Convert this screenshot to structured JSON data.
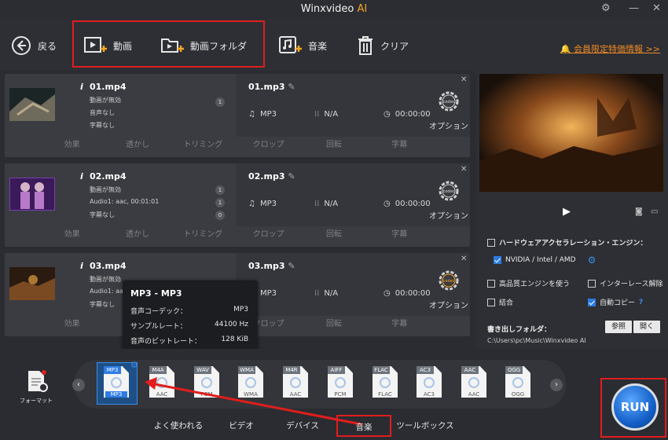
{
  "app": {
    "title_main": "Winxvideo ",
    "title_ai": "AI"
  },
  "toolbar": {
    "back": "戻る",
    "video": "動画",
    "video_folder": "動画フォルダ",
    "music": "音楽",
    "clear": "クリア",
    "member": "会員限定特価情報 >>"
  },
  "rows": [
    {
      "name": "01.mp4",
      "meta1": "動画が無効",
      "meta2": "音声なし",
      "meta3": "字幕なし",
      "badge": "1",
      "out_name": "01.mp3",
      "format": "MP3",
      "res": "N/A",
      "time": "00:00:00",
      "option": "オプション",
      "codec": "codec"
    },
    {
      "name": "02.mp4",
      "meta1": "動画が無効",
      "meta2": "Audio1: aac, 00:01:01",
      "meta3": "字幕なし",
      "badge": "1",
      "badge2": "0",
      "out_name": "02.mp3",
      "format": "MP3",
      "res": "N/A",
      "time": "00:00:00",
      "option": "オプション",
      "codec": "codec"
    },
    {
      "name": "03.mp4",
      "meta1": "動画が無効",
      "meta2": "Audio1: aac, 00:01:01",
      "meta3": "字幕なし",
      "badge": "1",
      "badge2": "0",
      "out_name": "03.mp3",
      "format": "MP3",
      "res": "N/A",
      "time": "00:00:00",
      "option": "オプション",
      "codec": "codec"
    }
  ],
  "editbar": [
    "効果",
    "透かし",
    "トリミング",
    "クロップ",
    "回転",
    "字幕"
  ],
  "tooltip": {
    "title": "MP3 - MP3",
    "rows": [
      {
        "k": "音声コーデック：",
        "v": "MP3"
      },
      {
        "k": "サンプルレート：",
        "v": "44100 Hz"
      },
      {
        "k": "音声のビットレート：",
        "v": "128 KiB"
      }
    ]
  },
  "options": {
    "hw_accel": "ハードウェアアクセラレーション・エンジン：",
    "nvidia": "NVIDIA / Intel / AMD",
    "hq": "高品質エンジンを使う",
    "deinterlace": "インターレース解除",
    "merge": "結合",
    "autocopy": "自動コピー",
    "autocopy_help": "?"
  },
  "output": {
    "label": "書き出しフォルダ：",
    "path": "C:\\Users\\pc\\Music\\Winxvideo AI",
    "browse": "参照",
    "open": "開く"
  },
  "formats": [
    {
      "tag": "MP3",
      "sub": "MP3",
      "selected": true
    },
    {
      "tag": "M4A",
      "sub": "AAC"
    },
    {
      "tag": "WAV",
      "sub": "PCM"
    },
    {
      "tag": "WMA",
      "sub": "WMA"
    },
    {
      "tag": "M4R",
      "sub": "AAC"
    },
    {
      "tag": "AIFF",
      "sub": "PCM"
    },
    {
      "tag": "FLAC",
      "sub": "FLAC"
    },
    {
      "tag": "AC3",
      "sub": "AC3"
    },
    {
      "tag": "AAC",
      "sub": "AAC"
    },
    {
      "tag": "OGG",
      "sub": "OGG"
    }
  ],
  "format_label": "フォーマット",
  "tabs": [
    "よく使われる",
    "ビデオ",
    "デバイス",
    "音楽",
    "ツールボックス"
  ],
  "run": "RUN",
  "colors": {
    "accent_red": "#e11d1d",
    "accent_orange": "#f08a24",
    "run_blue": "#1460c8"
  }
}
